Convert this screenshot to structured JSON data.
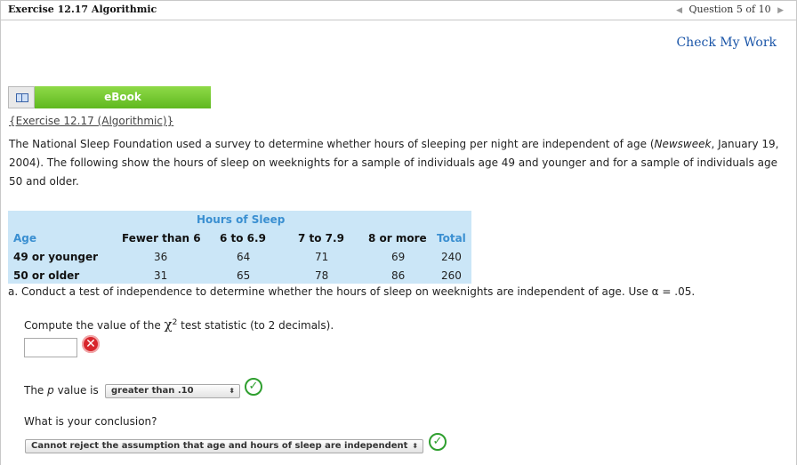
{
  "header": {
    "title": "Exercise 12.17 Algorithmic",
    "question_nav": "Question 5 of 10",
    "prev_icon": "◀",
    "next_icon": "▶"
  },
  "check_my_work": "Check My Work",
  "ebook": {
    "label": "eBook",
    "icon": "book-icon"
  },
  "exercise_link": "{Exercise 12.17 (Algorithmic)}",
  "intro": {
    "text_before": "The National Sleep Foundation used a survey to determine whether hours of sleeping per night are independent of age (",
    "source": "Newsweek",
    "text_after": ", January 19, 2004). The following show the hours of sleep on weeknights for a sample of individuals age 49 and younger and for a sample of individuals age 50 and older."
  },
  "table": {
    "group_header": "Hours of Sleep",
    "row_header": "Age",
    "columns": [
      "Fewer than 6",
      "6 to 6.9",
      "7 to 7.9",
      "8 or more",
      "Total"
    ],
    "rows": [
      {
        "label": "49 or younger",
        "values": [
          "36",
          "64",
          "71",
          "69",
          "240"
        ]
      },
      {
        "label": "50 or older",
        "values": [
          "31",
          "65",
          "78",
          "86",
          "260"
        ]
      }
    ]
  },
  "part_a": "a.  Conduct a test of independence to determine whether the hours of sleep on weeknights are independent of age. Use α = .05.",
  "q_statistic": {
    "before": "Compute the value of the ",
    "chi": "χ",
    "sup": "2",
    "after": " test statistic (to 2 decimals).",
    "value": "",
    "status_icon": "x-mark-icon"
  },
  "q_pvalue": {
    "label_before": "The ",
    "label_p": "p",
    "label_after": " value is",
    "selected": "greater than .10",
    "status_icon": "checkmark-icon"
  },
  "q_conclusion": {
    "label": "What is your conclusion?",
    "selected": "Cannot reject the assumption that age and hours of sleep are independent",
    "status_icon": "checkmark-icon"
  },
  "colors": {
    "accent_blue": "#3a8fd1",
    "link_blue": "#1a55a8",
    "ebook_green": "#6cc42a",
    "table_bg": "#cbe6f7",
    "error_red": "#d8262c",
    "ok_green": "#2f9f2f"
  }
}
